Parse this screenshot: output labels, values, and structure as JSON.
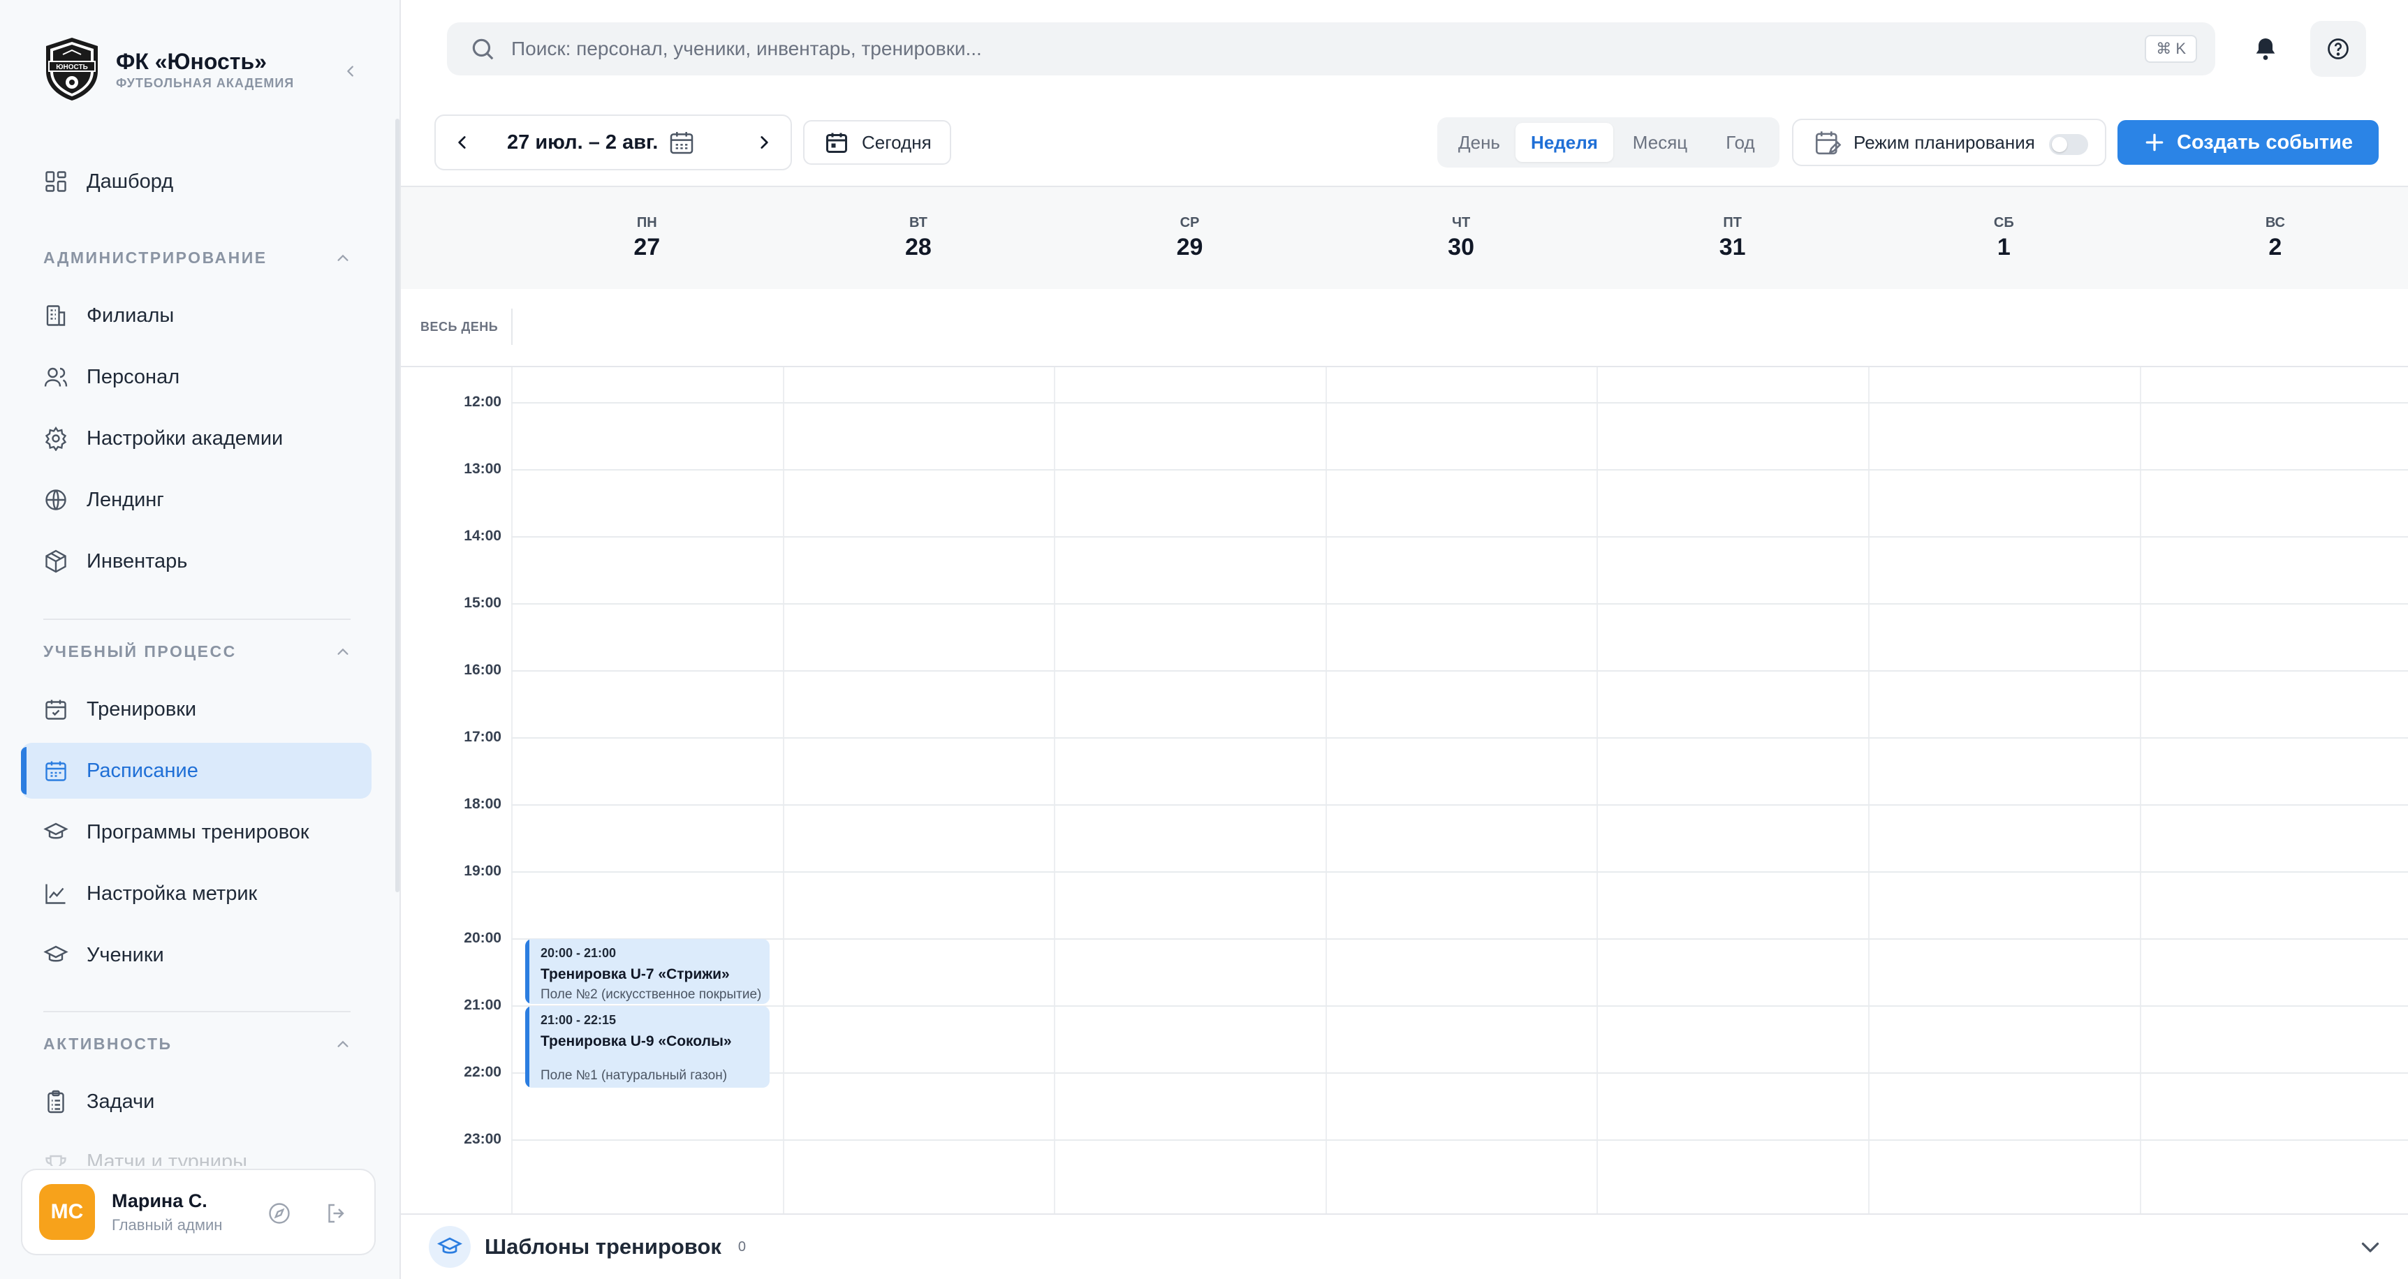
{
  "brand": {
    "title": "ФК «Юность»",
    "subtitle": "ФУТБОЛЬНАЯ АКАДЕМИЯ",
    "logo_text": "ЮНОСТЬ"
  },
  "sidebar": {
    "dashboard": "Дашборд",
    "sections": [
      {
        "title": "АДМИНИСТРИРОВАНИЕ",
        "items": [
          "Филиалы",
          "Персонал",
          "Настройки академии",
          "Лендинг",
          "Инвентарь"
        ]
      },
      {
        "title": "УЧЕБНЫЙ ПРОЦЕСС",
        "items": [
          "Тренировки",
          "Расписание",
          "Программы тренировок",
          "Настройка метрик",
          "Ученики"
        ]
      },
      {
        "title": "АКТИВНОСТЬ",
        "items": [
          "Задачи",
          "Матчи и турниры"
        ]
      }
    ],
    "active_item": "Расписание"
  },
  "user": {
    "initials": "МС",
    "name": "Марина С.",
    "role": "Главный админ"
  },
  "search": {
    "placeholder": "Поиск: персонал, ученики, инвентарь, тренировки...",
    "shortcut": "⌘ K"
  },
  "toolbar": {
    "date_range": "27 июл. – 2 авг.",
    "today": "Сегодня",
    "views": [
      "День",
      "Неделя",
      "Месяц",
      "Год"
    ],
    "active_view": "Неделя",
    "plan_mode": "Режим планирования",
    "plan_mode_on": false,
    "create": "Создать событие"
  },
  "calendar": {
    "all_day": "ВЕСЬ ДЕНЬ",
    "days": [
      {
        "name": "ПН",
        "num": "27"
      },
      {
        "name": "ВТ",
        "num": "28"
      },
      {
        "name": "СР",
        "num": "29"
      },
      {
        "name": "ЧТ",
        "num": "30"
      },
      {
        "name": "ПТ",
        "num": "31"
      },
      {
        "name": "СБ",
        "num": "1"
      },
      {
        "name": "ВС",
        "num": "2"
      }
    ],
    "hours": [
      "12:00",
      "13:00",
      "14:00",
      "15:00",
      "16:00",
      "17:00",
      "18:00",
      "19:00",
      "20:00",
      "21:00",
      "22:00",
      "23:00"
    ],
    "events": [
      {
        "time": "20:00 - 21:00",
        "title": "Тренировка U-7 «Стрижи»",
        "place": "Поле №2 (искусственное покрытие)"
      },
      {
        "time": "21:00 - 22:15",
        "title": "Тренировка U-9 «Соколы»",
        "place": "Поле №1 (натуральный газон)"
      }
    ]
  },
  "templates": {
    "title": "Шаблоны тренировок",
    "count": "0"
  },
  "colors": {
    "accent": "#2b84e6",
    "active_bg": "#dbeafb",
    "avatar": "#f7a21b",
    "event_bg": "#dcebfb"
  }
}
